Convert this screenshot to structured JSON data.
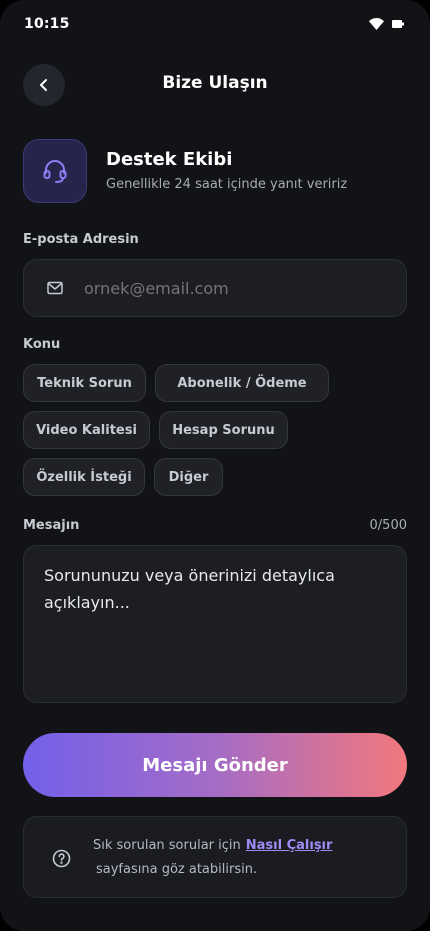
{
  "status_bar": {
    "time": "10:15",
    "wifi_icon": "wifi-icon",
    "battery_icon": "battery-icon"
  },
  "header": {
    "title": "Bize Ulaşın",
    "back_icon": "chevron-left-icon"
  },
  "support": {
    "icon": "headset-icon",
    "title": "Destek Ekibi",
    "subtitle": "Genellikle 24 saat içinde yanıt veririz"
  },
  "email": {
    "label": "E-posta Adresin",
    "icon": "mail-icon",
    "placeholder": "ornek@email.com",
    "value": ""
  },
  "subject": {
    "label": "Konu",
    "options": [
      "Teknik Sorun",
      "Abonelik / Ödeme",
      "Video Kalitesi",
      "Hesap Sorunu",
      "Özellik İsteği",
      "Diğer"
    ]
  },
  "message": {
    "label": "Mesajın",
    "counter": "0/500",
    "placeholder": "Sorununuzu veya önerinizi detaylıca açıklayın..."
  },
  "send_button": {
    "label": "Mesajı Gönder"
  },
  "faq": {
    "icon": "help-circle-icon",
    "text_before": "Sık sorulan sorular için",
    "link_label": "Nasıl Çalışır",
    "text_after": "sayfasına  göz atabilirsin."
  },
  "colors": {
    "background": "#121316",
    "accent_start": "#7360ea",
    "accent_end": "#f2787d",
    "link": "#9d8df4"
  }
}
